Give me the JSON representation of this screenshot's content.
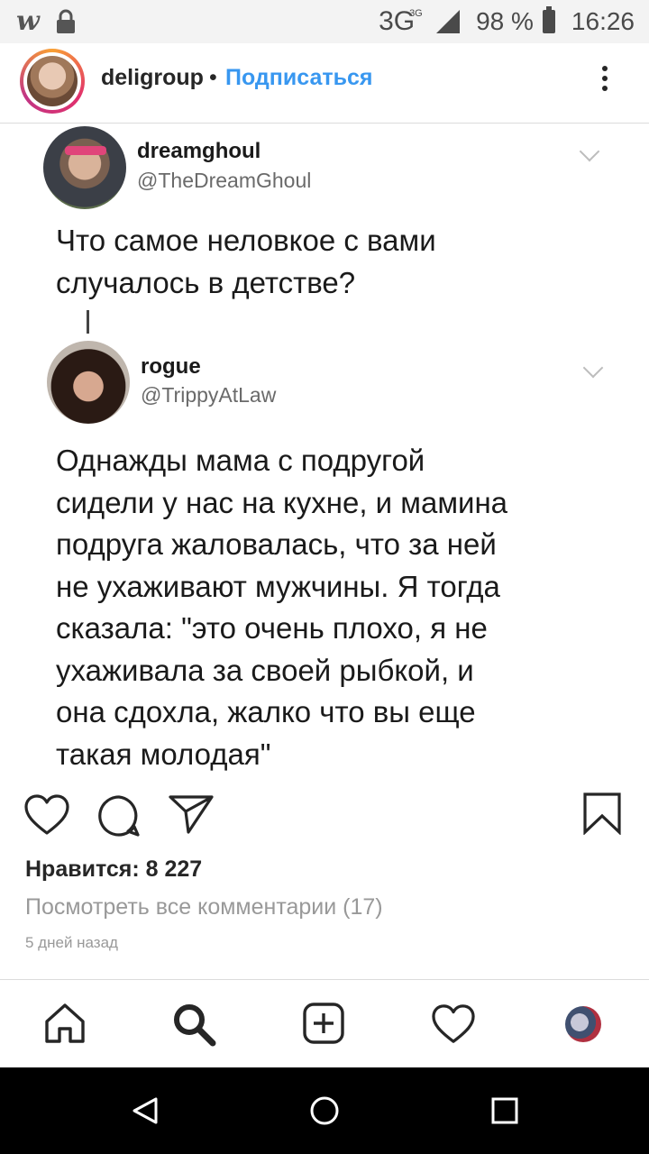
{
  "status_bar": {
    "network": "3G",
    "network_sup": "3G",
    "battery": "98 %",
    "time": "16:26",
    "icons": [
      "wattpad-icon",
      "lock-icon",
      "signal-icon",
      "battery-icon"
    ]
  },
  "post_header": {
    "username": "deligroup",
    "separator": "•",
    "follow_label": "Подписаться",
    "follow_color": "#3897f0"
  },
  "tweets": [
    {
      "name": "dreamghoul",
      "handle": "@TheDreamGhoul",
      "text": "Что самое неловкое с вами\nслучалось в детстве?"
    },
    {
      "name": "rogue",
      "handle": "@TrippyAtLaw",
      "text": "Однажды мама с подругой\nсидели у нас на кухне, и мамина\nподруга жаловалась, что за ней\nне ухаживают мужчины. Я тогда\nсказала: \"это очень плохо, я не\nухаживала за своей рыбкой, и\nона сдохла, жалко что вы еще\nтакая молодая\""
    }
  ],
  "post_footer": {
    "likes": "Нравится: 8 227",
    "view_comments": "Посмотреть все комментарии (17)",
    "timestamp": "5 дней назад"
  },
  "bottom_nav": [
    "home-icon",
    "search-icon",
    "new-post-icon",
    "activity-heart-icon",
    "profile-avatar"
  ],
  "android_nav": [
    "back-icon",
    "home-circle-icon",
    "recents-icon"
  ]
}
